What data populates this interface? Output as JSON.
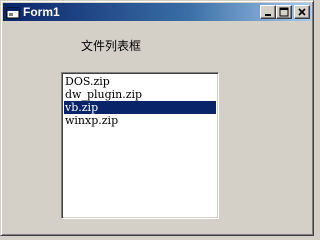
{
  "window": {
    "title": "Form1"
  },
  "label": {
    "text": "文件列表框"
  },
  "file_list": {
    "items": [
      "DOS.zip",
      "dw_plugin.zip",
      "vb.zip",
      "winxp.zip"
    ],
    "selected": "vb.zip"
  },
  "colors": {
    "titlebar_start": "#0a246a",
    "titlebar_end": "#a6caf0",
    "selection": "#0a246a",
    "face": "#d4d0c8"
  }
}
